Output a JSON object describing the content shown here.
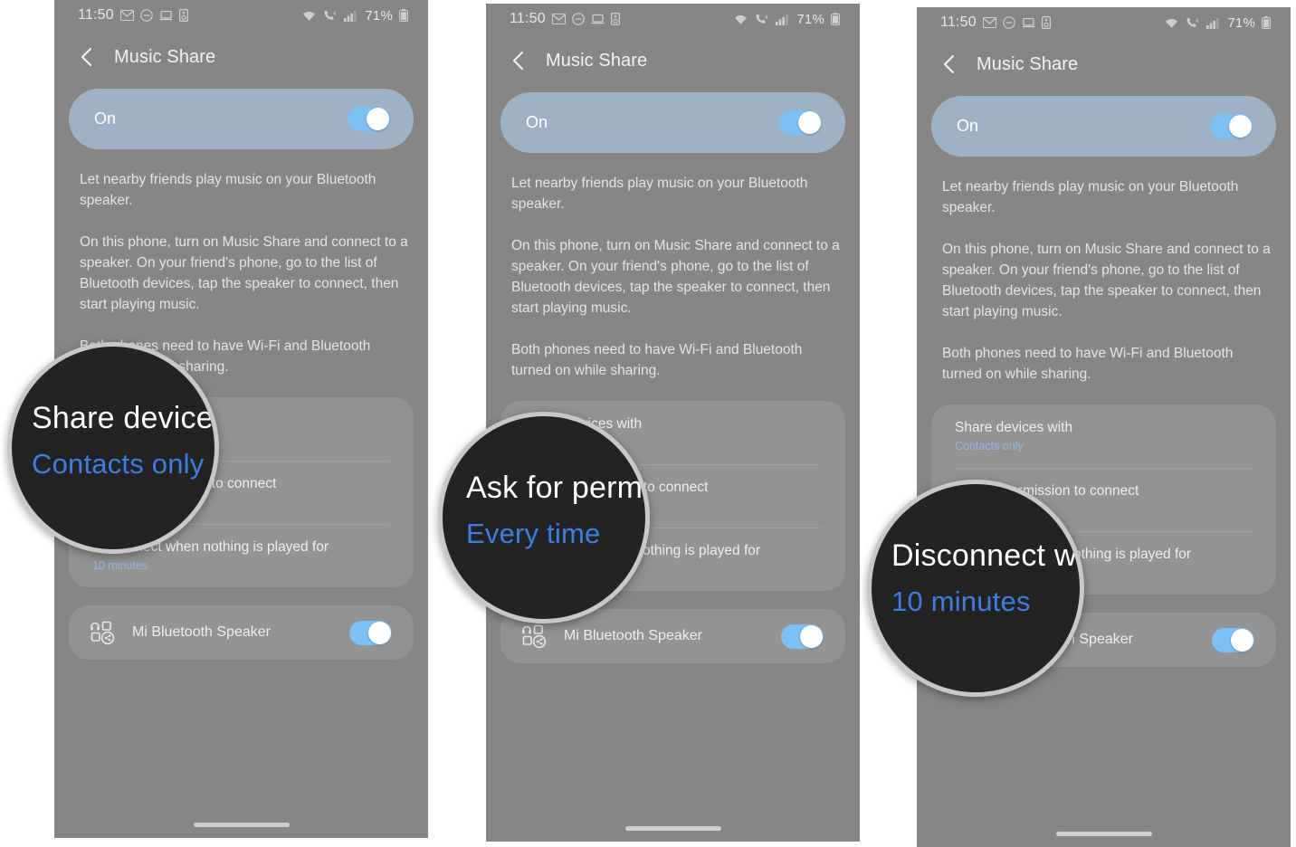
{
  "status_bar": {
    "time": "11:50",
    "battery_percent": "71%",
    "left_icons": [
      "envelope-icon",
      "do-not-disturb-icon",
      "laptop-icon",
      "smart-view-icon"
    ],
    "right_icons": [
      "wifi-icon",
      "volte-call-icon",
      "signal-bars-icon",
      "battery-icon"
    ]
  },
  "app_bar": {
    "back_label": "Back",
    "title": "Music Share"
  },
  "master_toggle": {
    "label": "On",
    "state": "on"
  },
  "description": {
    "paragraph_1": "Let nearby friends play music on your Bluetooth speaker.",
    "paragraph_2": "On this phone, turn on Music Share and connect to a speaker. On your friend's phone, go to the list of Bluetooth devices, tap the speaker to connect, then start playing music.",
    "paragraph_3": "Both phones need to have Wi-Fi and Bluetooth turned on while sharing."
  },
  "settings_rows": [
    {
      "title": "Share devices with",
      "value": "Contacts only"
    },
    {
      "title": "Ask for permission to connect",
      "value": "Every time"
    },
    {
      "title": "Disconnect when nothing is played for",
      "value": "10 minutes"
    }
  ],
  "device": {
    "name": "Mi Bluetooth Speaker",
    "icon": "music-share-device-icon",
    "state": "on"
  },
  "magnifiers": [
    {
      "title": "Share devices with",
      "value": "Contacts only"
    },
    {
      "title": "Ask for permission to connect",
      "value": "Every time"
    },
    {
      "title": "Disconnect when nothing is played for",
      "value": "10 minutes"
    }
  ],
  "colors": {
    "page_background": "#868686",
    "master_card": "#9fb1c4",
    "card": "#939393",
    "accent_blue": "#7cc0f5",
    "value_text": "#8fb6e6",
    "magnifier_fill": "#232323",
    "magnifier_ring": "#c8c8c8",
    "magnifier_value": "#3d7fe0"
  }
}
